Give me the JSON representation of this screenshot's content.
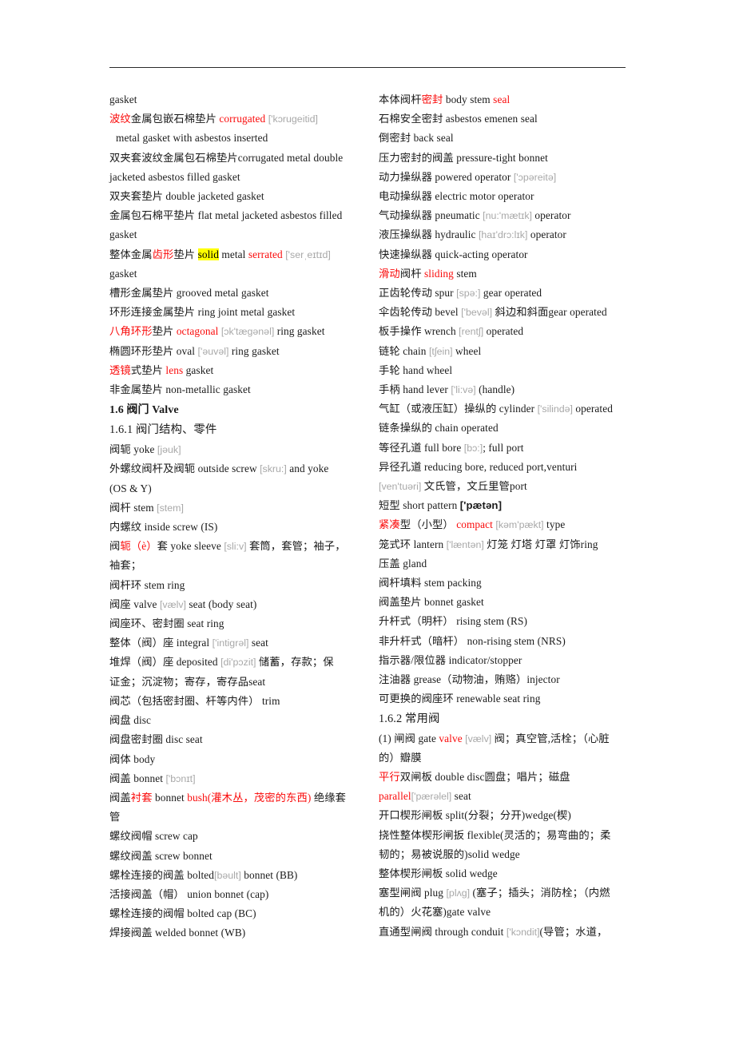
{
  "document": {
    "kind": "bilingual-glossary-page",
    "rule_visible": true,
    "accent_red": "#fa0a0a",
    "phonetic_gray": "#a8a8a8",
    "highlight_yellow": "#ffff00"
  },
  "left_column": [
    {
      "id": "l1",
      "type": "entry",
      "text": "gasket"
    },
    {
      "id": "l2",
      "type": "entry",
      "text": "波纹金属包嵌石棉垫片  corrugated ['kɔrugeitid]"
    },
    {
      "id": "l3",
      "type": "entry",
      "indent": true,
      "text": "metal gasket with asbestos inserted"
    },
    {
      "id": "l4",
      "type": "entry",
      "text": "双夹套波纹金属包石棉垫片corrugated metal double"
    },
    {
      "id": "l5",
      "type": "entry",
      "text": "jacketed  asbestos filled gasket"
    },
    {
      "id": "l6",
      "type": "entry",
      "text": "双夹套垫片  double jacketed gasket"
    },
    {
      "id": "l7",
      "type": "entry",
      "text": "金属包石棉平垫片  flat metal jacketed asbestos filled"
    },
    {
      "id": "l8",
      "type": "entry",
      "text": "gasket"
    },
    {
      "id": "l9",
      "type": "entry",
      "text": "整体金属齿形垫片  solid metal serrated ['serˌeɪtɪd]"
    },
    {
      "id": "l10",
      "type": "entry",
      "text": "gasket"
    },
    {
      "id": "l11",
      "type": "entry",
      "text": "槽形金属垫片  grooved metal gasket"
    },
    {
      "id": "l12",
      "type": "entry",
      "text": "环形连接金属垫片  ring joint metal gasket"
    },
    {
      "id": "l13",
      "type": "entry",
      "text": "八角环形垫片  octagonal [ɔk'tægənəl] ring gasket"
    },
    {
      "id": "l14",
      "type": "entry",
      "text": "椭圆环形垫片  oval ['əuvəl] ring gasket"
    },
    {
      "id": "l15",
      "type": "entry",
      "text": "透镜式垫片  lens gasket"
    },
    {
      "id": "l16",
      "type": "entry",
      "text": "非金属垫片  non-metallic gasket"
    },
    {
      "id": "l17",
      "type": "heading",
      "text": "1.6  阀门  Valve"
    },
    {
      "id": "l18",
      "type": "subheading",
      "text": "1.6.1  阀门结构、零件"
    },
    {
      "id": "l19",
      "type": "entry",
      "text": "阀轭  yoke [jəuk]"
    },
    {
      "id": "l20",
      "type": "entry",
      "text": "外螺纹阀杆及阀轭  outside screw [skru:] and yoke"
    },
    {
      "id": "l21",
      "type": "entry",
      "text": "(OS & Y)"
    },
    {
      "id": "l22",
      "type": "entry",
      "text": "阀杆  stem [stem]"
    },
    {
      "id": "l23",
      "type": "entry",
      "text": "内螺纹  inside screw (IS)"
    },
    {
      "id": "l24",
      "type": "entry",
      "text": "阀轭（è）套  yoke sleeve [sli:v] 套筒，套管；袖子，"
    },
    {
      "id": "l25",
      "type": "entry",
      "text": "袖套；"
    },
    {
      "id": "l26",
      "type": "entry",
      "text": "阀杆环  stem ring"
    },
    {
      "id": "l27",
      "type": "entry",
      "text": "阀座  valve [vælv] seat (body seat)"
    },
    {
      "id": "l28",
      "type": "entry",
      "text": "阀座环、密封圈  seat ring"
    },
    {
      "id": "l29",
      "type": "entry",
      "text": "整体（阀）座  integral ['intigrəl] seat"
    },
    {
      "id": "l30",
      "type": "entry",
      "text": "堆焊（阀）座  deposited [di'pɔzit] 储蓄，存款；保"
    },
    {
      "id": "l31",
      "type": "entry",
      "text": "证金；沉淀物；寄存，寄存品seat"
    },
    {
      "id": "l32",
      "type": "entry",
      "text": "阀芯（包括密封圈、杆等内件）  trim"
    },
    {
      "id": "l33",
      "type": "entry",
      "text": "阀盘  disc"
    },
    {
      "id": "l34",
      "type": "entry",
      "text": "阀盘密封圈  disc seat"
    },
    {
      "id": "l35",
      "type": "entry",
      "text": "阀体  body"
    },
    {
      "id": "l36",
      "type": "entry",
      "text": "阀盖  bonnet ['bɔnɪt]"
    },
    {
      "id": "l37",
      "type": "entry",
      "text": "阀盖衬套 bonnet bush(灌木丛，茂密的东西) 绝缘套"
    },
    {
      "id": "l38",
      "type": "entry",
      "text": "管"
    },
    {
      "id": "l39",
      "type": "entry",
      "text": "螺纹阀帽  screw cap"
    },
    {
      "id": "l40",
      "type": "entry",
      "text": "螺纹阀盖  screw bonnet"
    },
    {
      "id": "l41",
      "type": "entry",
      "text": "螺栓连接的阀盖  bolted[bəult] bonnet (BB)"
    },
    {
      "id": "l42",
      "type": "entry",
      "text": "活接阀盖（帽）  union bonnet (cap)"
    },
    {
      "id": "l43",
      "type": "entry",
      "text": "螺栓连接的阀帽  bolted cap (BC)"
    },
    {
      "id": "l44",
      "type": "entry",
      "text": "焊接阀盖  welded bonnet (WB)"
    }
  ],
  "right_column": [
    {
      "id": "r1",
      "type": "entry",
      "text": "本体阀杆密封  body stem seal"
    },
    {
      "id": "r2",
      "type": "entry",
      "text": "石棉安全密封  asbestos emenen seal"
    },
    {
      "id": "r3",
      "type": "entry",
      "text": "倒密封  back seal"
    },
    {
      "id": "r4",
      "type": "entry",
      "text": "压力密封的阀盖  pressure-tight bonnet"
    },
    {
      "id": "r5",
      "type": "entry",
      "text": "动力操纵器  powered operator ['ɔpəreitə]"
    },
    {
      "id": "r6",
      "type": "entry",
      "text": "电动操纵器  electric motor operator"
    },
    {
      "id": "r7",
      "type": "entry",
      "text": "气动操纵器  pneumatic [nu:'mætɪk] operator"
    },
    {
      "id": "r8",
      "type": "entry",
      "text": "液压操纵器  hydraulic [haɪ'drɔ:lɪk] operator"
    },
    {
      "id": "r9",
      "type": "entry",
      "text": "快速操纵器  quick-acting operator"
    },
    {
      "id": "r10",
      "type": "entry",
      "text": "滑动阀杆  sliding stem"
    },
    {
      "id": "r11",
      "type": "entry",
      "text": "正齿轮传动  spur [spə:] gear operated"
    },
    {
      "id": "r12",
      "type": "entry",
      "text": "伞齿轮传动  bevel ['bevəl] 斜边和斜面gear operated"
    },
    {
      "id": "r13",
      "type": "entry",
      "text": "板手操作  wrench [rentʃ] operated"
    },
    {
      "id": "r14",
      "type": "entry",
      "text": "链轮  chain [tʃein] wheel"
    },
    {
      "id": "r15",
      "type": "entry",
      "text": "手轮  hand wheel"
    },
    {
      "id": "r16",
      "type": "entry",
      "text": "手柄  hand lever ['li:və] (handle)"
    },
    {
      "id": "r17",
      "type": "entry",
      "text": "气缸（或液压缸）操纵的  cylinder ['silində] operated"
    },
    {
      "id": "r18",
      "type": "entry",
      "text": "链条操纵的  chain operated"
    },
    {
      "id": "r19",
      "type": "entry",
      "text": "等径孔道  full bore [bɔ:]; full port"
    },
    {
      "id": "r20",
      "type": "entry",
      "text": "异径孔道  reducing bore, reduced port,venturi"
    },
    {
      "id": "r21",
      "type": "entry",
      "text": "[ven'tuəri] 文氏管，文丘里管port"
    },
    {
      "id": "r22",
      "type": "entry",
      "text": "短型  short pattern ['pætən]"
    },
    {
      "id": "r23",
      "type": "entry",
      "text": "紧凑型（小型）  compact [kəm'pækt] type"
    },
    {
      "id": "r24",
      "type": "entry",
      "text": "笼式环  lantern ['læntən] 灯笼 灯塔 灯罩 灯饰ring"
    },
    {
      "id": "r25",
      "type": "entry",
      "text": "压盖  gland"
    },
    {
      "id": "r26",
      "type": "entry",
      "text": "阀杆填料  stem packing"
    },
    {
      "id": "r27",
      "type": "entry",
      "text": "阀盖垫片  bonnet gasket"
    },
    {
      "id": "r28",
      "type": "entry",
      "text": "升杆式（明杆）  rising stem (RS)"
    },
    {
      "id": "r29",
      "type": "entry",
      "text": "非升杆式（暗杆）  non-rising stem (NRS)"
    },
    {
      "id": "r30",
      "type": "entry",
      "text": "指示器/限位器  indicator/stopper"
    },
    {
      "id": "r31",
      "type": "entry",
      "text": "注油器  grease（动物油，贿赂）injector"
    },
    {
      "id": "r32",
      "type": "entry",
      "text": "可更换的阀座环  renewable seat ring"
    },
    {
      "id": "r33",
      "type": "subheading",
      "text": "1.6.2  常用阀"
    },
    {
      "id": "r34",
      "type": "entry",
      "text": "(1)  闸阀  gate valve [vælv] 阀；真空管,活栓；（心脏"
    },
    {
      "id": "r35",
      "type": "entry",
      "text": "的）瓣膜"
    },
    {
      "id": "r36",
      "type": "entry",
      "text": "平行双闸板  double disc圆盘；唱片；磁盘"
    },
    {
      "id": "r37",
      "type": "entry",
      "text": "parallel['pærəlel] seat"
    },
    {
      "id": "r38",
      "type": "entry",
      "text": "开口楔形闸板  split(分裂；分开)wedge(楔)"
    },
    {
      "id": "r39",
      "type": "entry",
      "text": "挠性整体楔形闸扳  flexible(灵活的；易弯曲的；柔"
    },
    {
      "id": "r40",
      "type": "entry",
      "text": "韧的；易被说服的)solid wedge"
    },
    {
      "id": "r41",
      "type": "entry",
      "text": "整体楔形闸板  solid wedge"
    },
    {
      "id": "r42",
      "type": "entry",
      "text": "塞型闸阀  plug [plʌg] (塞子；插头；消防栓；（内燃"
    },
    {
      "id": "r43",
      "type": "entry",
      "text": "机的）火花塞)gate valve"
    },
    {
      "id": "r44",
      "type": "entry",
      "text": "直通型闸阀  through conduit ['kɔndit](导管；水道，"
    }
  ],
  "rich_runs": {
    "l2": [
      {
        "t": "波纹",
        "c": "r"
      },
      {
        "t": "金属包嵌石棉垫片  "
      },
      {
        "t": "corrugated",
        "c": "r"
      },
      {
        "t": " "
      },
      {
        "t": "['kɔrugeitid]",
        "c": "ph"
      }
    ],
    "l9": [
      {
        "t": "整体金属"
      },
      {
        "t": "齿形",
        "c": "r"
      },
      {
        "t": "垫片  "
      },
      {
        "t": "solid",
        "c": "hl"
      },
      {
        "t": " metal "
      },
      {
        "t": "serrated",
        "c": "r"
      },
      {
        "t": " "
      },
      {
        "t": "['serˌeɪtɪd]",
        "c": "ph"
      }
    ],
    "l13": [
      {
        "t": "八角环形",
        "c": "r"
      },
      {
        "t": "垫片  "
      },
      {
        "t": "octagonal",
        "c": "r"
      },
      {
        "t": " "
      },
      {
        "t": "[ɔk'tægənəl]",
        "c": "ph"
      },
      {
        "t": " ring gasket"
      }
    ],
    "l14": [
      {
        "t": "椭圆环形垫片  oval "
      },
      {
        "t": "['əuvəl]",
        "c": "ph"
      },
      {
        "t": " ring gasket"
      }
    ],
    "l15": [
      {
        "t": "透镜",
        "c": "r"
      },
      {
        "t": "式垫片  "
      },
      {
        "t": "lens",
        "c": "r"
      },
      {
        "t": " gasket"
      }
    ],
    "l19": [
      {
        "t": "阀轭  yoke "
      },
      {
        "t": "[jəuk]",
        "c": "ph"
      }
    ],
    "l20": [
      {
        "t": "外螺纹阀杆及阀轭  outside screw "
      },
      {
        "t": "[skru:]",
        "c": "ph"
      },
      {
        "t": " and yoke"
      }
    ],
    "l22": [
      {
        "t": "阀杆  stem "
      },
      {
        "t": "[stem]",
        "c": "ph"
      }
    ],
    "l24": [
      {
        "t": "阀"
      },
      {
        "t": "轭（è）",
        "c": "r"
      },
      {
        "t": "套  yoke sleeve "
      },
      {
        "t": "[sli:v]",
        "c": "ph"
      },
      {
        "t": " 套筒，套管；袖子，"
      }
    ],
    "l27": [
      {
        "t": "阀座  valve "
      },
      {
        "t": "[vælv]",
        "c": "ph"
      },
      {
        "t": " seat (body seat)"
      }
    ],
    "l29": [
      {
        "t": "整体（阀）座  integral "
      },
      {
        "t": "['intigrəl]",
        "c": "ph"
      },
      {
        "t": " seat"
      }
    ],
    "l30": [
      {
        "t": "堆焊（阀）座  deposited "
      },
      {
        "t": "[di'pɔzit]",
        "c": "ph"
      },
      {
        "t": " 储蓄，存款；保"
      }
    ],
    "l36": [
      {
        "t": "阀盖  bonnet "
      },
      {
        "t": "['bɔnɪt]",
        "c": "ph"
      }
    ],
    "l37": [
      {
        "t": "阀盖"
      },
      {
        "t": "衬套",
        "c": "r"
      },
      {
        "t": " bonnet "
      },
      {
        "t": "bush(灌木丛，茂密的东西)",
        "c": "r"
      },
      {
        "t": " 绝缘套"
      }
    ],
    "l41": [
      {
        "t": "螺栓连接的阀盖  bolted"
      },
      {
        "t": "[bəult]",
        "c": "ph"
      },
      {
        "t": " bonnet (BB)"
      }
    ],
    "r1": [
      {
        "t": "本体阀杆"
      },
      {
        "t": "密封",
        "c": "r"
      },
      {
        "t": "  body stem "
      },
      {
        "t": "seal",
        "c": "r"
      }
    ],
    "r5": [
      {
        "t": "动力操纵器  powered operator "
      },
      {
        "t": "['ɔpəreitə]",
        "c": "ph"
      }
    ],
    "r7": [
      {
        "t": "气动操纵器  pneumatic "
      },
      {
        "t": "[nu:'mætɪk]",
        "c": "ph"
      },
      {
        "t": " operator"
      }
    ],
    "r8": [
      {
        "t": "液压操纵器  hydraulic "
      },
      {
        "t": "[haɪ'drɔ:lɪk]",
        "c": "ph"
      },
      {
        "t": " operator"
      }
    ],
    "r10": [
      {
        "t": "滑动",
        "c": "r"
      },
      {
        "t": "阀杆  "
      },
      {
        "t": "sliding",
        "c": "r"
      },
      {
        "t": " stem"
      }
    ],
    "r11": [
      {
        "t": "正齿轮传动  spur "
      },
      {
        "t": "[spə:]",
        "c": "ph"
      },
      {
        "t": " gear operated"
      }
    ],
    "r12": [
      {
        "t": "伞齿轮传动  bevel "
      },
      {
        "t": "['bevəl]",
        "c": "ph"
      },
      {
        "t": " 斜边和斜面gear operated"
      }
    ],
    "r13": [
      {
        "t": "板手操作  wrench "
      },
      {
        "t": "[rentʃ]",
        "c": "ph"
      },
      {
        "t": " operated"
      }
    ],
    "r14": [
      {
        "t": "链轮  chain "
      },
      {
        "t": "[tʃein]",
        "c": "ph"
      },
      {
        "t": " wheel"
      }
    ],
    "r16": [
      {
        "t": "手柄  hand lever "
      },
      {
        "t": "['li:və]",
        "c": "ph"
      },
      {
        "t": " (handle)"
      }
    ],
    "r17": [
      {
        "t": "气缸（或液压缸）操纵的  cylinder "
      },
      {
        "t": "['silində]",
        "c": "ph"
      },
      {
        "t": " operated"
      }
    ],
    "r19": [
      {
        "t": "等径孔道  full bore "
      },
      {
        "t": "[bɔ:]",
        "c": "ph"
      },
      {
        "t": "; full port"
      }
    ],
    "r21": [
      {
        "t": "[ven'tuəri]",
        "c": "ph"
      },
      {
        "t": " 文氏管，文丘里管port"
      }
    ],
    "r22": [
      {
        "t": "短型  short pattern "
      },
      {
        "t": "['pætən]",
        "c": "ph-b"
      }
    ],
    "r23": [
      {
        "t": "紧凑",
        "c": "r"
      },
      {
        "t": "型（小型）  "
      },
      {
        "t": "compact",
        "c": "r"
      },
      {
        "t": " "
      },
      {
        "t": "[kəm'pækt]",
        "c": "ph"
      },
      {
        "t": " type"
      }
    ],
    "r24": [
      {
        "t": "笼式环  lantern "
      },
      {
        "t": "['læntən]",
        "c": "ph"
      },
      {
        "t": " 灯笼 灯塔 灯罩 灯饰ring"
      }
    ],
    "r34": [
      {
        "t": "(1)  闸阀  gate "
      },
      {
        "t": "valve",
        "c": "r"
      },
      {
        "t": " "
      },
      {
        "t": "[vælv]",
        "c": "ph"
      },
      {
        "t": " 阀；真空管,活栓；（心脏"
      }
    ],
    "r36": [
      {
        "t": "平行",
        "c": "r"
      },
      {
        "t": "双闸板  double disc圆盘；唱片；磁盘"
      }
    ],
    "r37": [
      {
        "t": "parallel",
        "c": "r"
      },
      {
        "t": "['pærəlel]",
        "c": "ph"
      },
      {
        "t": " seat"
      }
    ],
    "r42": [
      {
        "t": "塞型闸阀  plug "
      },
      {
        "t": "[plʌg]",
        "c": "ph"
      },
      {
        "t": " (塞子；插头；消防栓；（内燃"
      }
    ],
    "r44": [
      {
        "t": "直通型闸阀  through conduit "
      },
      {
        "t": "['kɔndit]",
        "c": "ph"
      },
      {
        "t": "(导管；水道，"
      }
    ]
  }
}
